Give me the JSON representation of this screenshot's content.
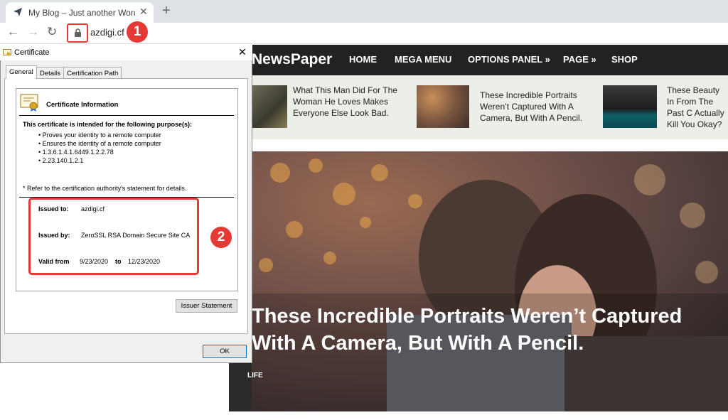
{
  "browser": {
    "tab_title": "My Blog – Just another WordPre",
    "url": "azdigi.cf",
    "new_tab_symbol": "+",
    "close_symbol": "✕",
    "back_symbol": "←",
    "forward_symbol": "→",
    "reload_symbol": "↻",
    "badge_1": "1",
    "accent_color": "#e53935"
  },
  "site": {
    "logo": "NewsPaper",
    "nav": [
      "HOME",
      "MEGA MENU",
      "OPTIONS PANEL »",
      "PAGE »",
      "SHOP"
    ],
    "strip_posts": [
      {
        "title": "What This Man Did For The Woman He Loves Makes Everyone Else Look Bad."
      },
      {
        "title": "These Incredible Portraits Weren’t Captured With A Camera, But With A Pencil."
      },
      {
        "title": "These Beauty In From The Past C Actually Kill You Okay?"
      }
    ],
    "hero": {
      "title": "These Incredible Portraits Weren’t Captured With A Camera, But With A Pencil.",
      "category": "LIFE"
    }
  },
  "dialog": {
    "title": "Certificate",
    "tabs": [
      "General",
      "Details",
      "Certification Path"
    ],
    "info_heading": "Certificate Information",
    "purpose_heading": "This certificate is intended for the following purpose(s):",
    "purposes": [
      "• Proves your identity to a remote computer",
      "• Ensures the identity of a remote computer",
      "• 1.3.6.1.4.1.6449.1.2.2.78",
      "• 2.23.140.1.2.1"
    ],
    "refer_note": "* Refer to the certification authority's statement for details.",
    "issued_to_label": "Issued to:",
    "issued_to": "azdigi.cf",
    "issued_by_label": "Issued by:",
    "issued_by": "ZeroSSL RSA Domain Secure Site CA",
    "valid_from_label": "Valid from",
    "valid_from": "9/23/2020",
    "to_label": "to",
    "valid_to": "12/23/2020",
    "issuer_statement_button": "Issuer Statement",
    "ok_button": "OK",
    "close_symbol": "✕",
    "badge_2": "2"
  }
}
